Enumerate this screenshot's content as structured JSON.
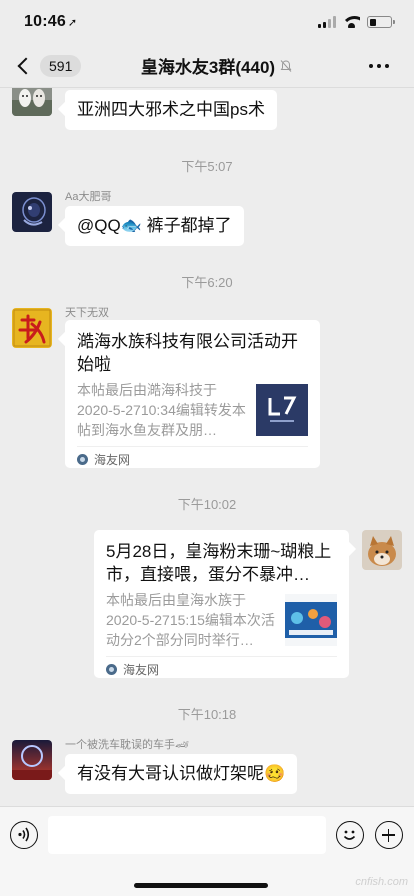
{
  "status": {
    "time": "10:46"
  },
  "nav": {
    "unread_count": "591",
    "title": "皇海水友3群(440)"
  },
  "messages": [
    {
      "type": "text",
      "text": "亚洲四大邪术之中国ps术"
    },
    {
      "type": "time",
      "text": "下午5:07"
    },
    {
      "type": "text",
      "sender": "Aa大肥哥",
      "text": "@QQ🐟 裤子都掉了"
    },
    {
      "type": "time",
      "text": "下午6:20"
    },
    {
      "type": "card",
      "sender": "天下无双",
      "title": "澔海水族科技有限公司活动开始啦",
      "desc": "本帖最后由澔海科技于2020-5-2710:34编辑转发本帖到海水鱼友群及朋…",
      "source": "海友网"
    },
    {
      "type": "time",
      "text": "下午10:02"
    },
    {
      "type": "card",
      "side": "right",
      "title": "5月28日，皇海粉末珊~瑚粮上市，直接喂，蛋分不暴冲…",
      "desc": "本帖最后由皇海水族于2020-5-2715:15编辑本次活动分2个部分同时举行…",
      "source": "海友网"
    },
    {
      "type": "time",
      "text": "下午10:18"
    },
    {
      "type": "text",
      "sender": "一个被洗车耽误的车手🏎",
      "text": "有没有大哥认识做灯架呢🥴"
    }
  ],
  "watermark": "cnfish.com",
  "colors": {
    "background": "#ededed",
    "bubble": "#ffffff",
    "timestamp": "#9a9a9a",
    "card_desc": "#9b9b9b"
  },
  "icons": [
    "back-chevron-icon",
    "mute-bell-icon",
    "more-dots-icon",
    "voice-icon",
    "emoji-icon",
    "plus-icon",
    "wifi-icon",
    "battery-icon"
  ]
}
